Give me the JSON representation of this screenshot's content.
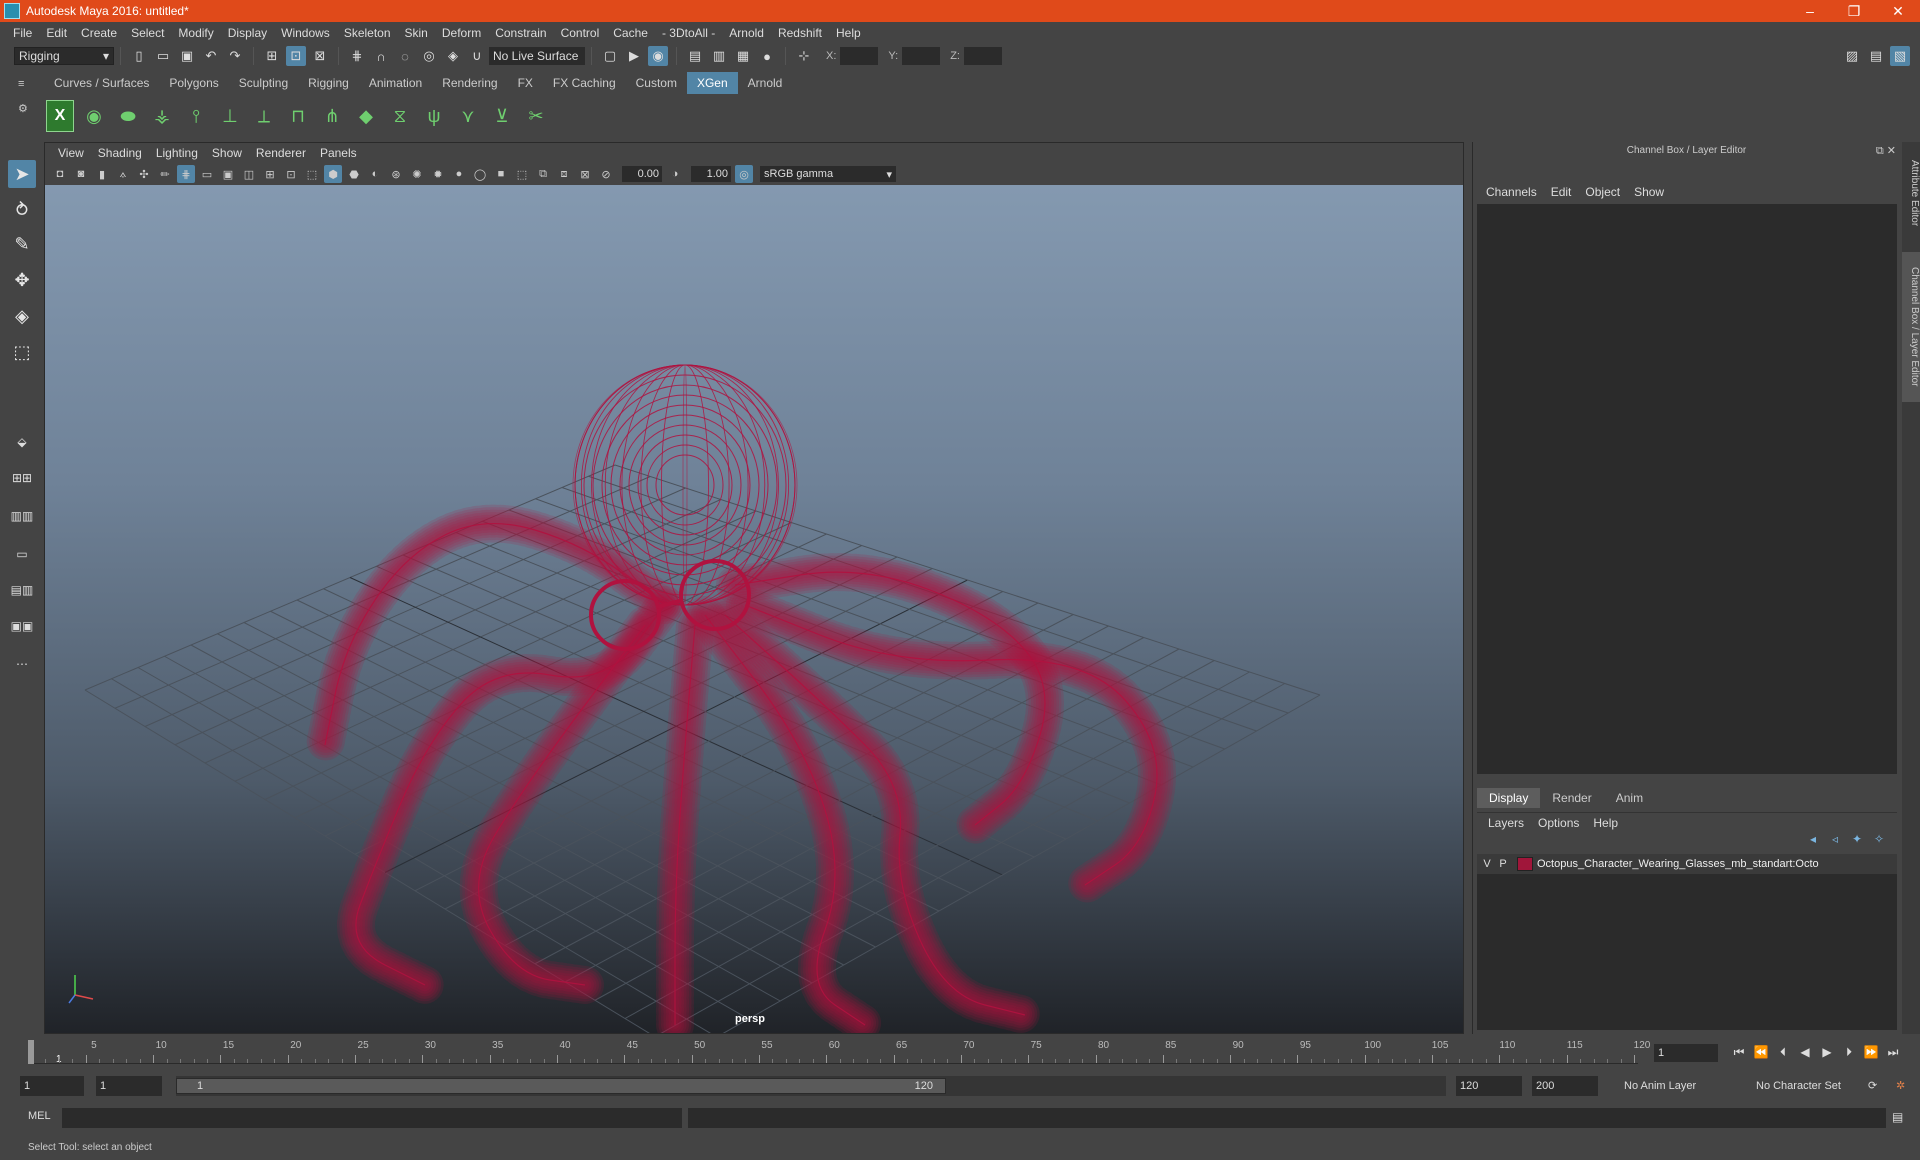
{
  "window": {
    "title": "Autodesk Maya 2016: untitled*",
    "minimize": "–",
    "restore": "❐",
    "close": "✕"
  },
  "menubar": [
    "File",
    "Edit",
    "Create",
    "Select",
    "Modify",
    "Display",
    "Windows",
    "Skeleton",
    "Skin",
    "Deform",
    "Constrain",
    "Control",
    "Cache",
    "- 3DtoAll -",
    "Arnold",
    "Redshift",
    "Help"
  ],
  "statusline": {
    "mode": "Rigging",
    "live_surface": "No Live Surface",
    "x_label": "X:",
    "y_label": "Y:",
    "z_label": "Z:"
  },
  "shelf": {
    "tabs": [
      "Curves / Surfaces",
      "Polygons",
      "Sculpting",
      "Rigging",
      "Animation",
      "Rendering",
      "FX",
      "FX Caching",
      "Custom",
      "XGen",
      "Arnold"
    ],
    "active_tab": "XGen",
    "xgen_label": "X"
  },
  "viewport": {
    "menu": [
      "View",
      "Shading",
      "Lighting",
      "Show",
      "Renderer",
      "Panels"
    ],
    "exposure": "0.00",
    "gamma": "1.00",
    "color_space": "sRGB gamma",
    "camera": "persp",
    "wire_color": "#b0123f"
  },
  "channel_box": {
    "title": "Channel Box / Layer Editor",
    "menu": [
      "Channels",
      "Edit",
      "Object",
      "Show"
    ]
  },
  "layer_editor": {
    "tabs": [
      "Display",
      "Render",
      "Anim"
    ],
    "active_tab": "Display",
    "menu": [
      "Layers",
      "Options",
      "Help"
    ],
    "layers": [
      {
        "v": "V",
        "p": "P",
        "color": "#a0163a",
        "name": "Octopus_Character_Wearing_Glasses_mb_standart:Octo"
      }
    ]
  },
  "side_tabs": [
    "Attribute Editor",
    "Channel Box / Layer Editor"
  ],
  "timeslider": {
    "ticks": [
      1,
      5,
      10,
      15,
      20,
      25,
      30,
      35,
      40,
      45,
      50,
      55,
      60,
      65,
      70,
      75,
      80,
      85,
      90,
      95,
      100,
      105,
      110,
      115,
      120
    ],
    "current_frame": "1",
    "current_frame_field": "1"
  },
  "range": {
    "start": "1",
    "playback_start": "1",
    "range_start": "1",
    "range_end": "120",
    "playback_end": "120",
    "end": "200",
    "anim_layer": "No Anim Layer",
    "character_set": "No Character Set"
  },
  "command_line": {
    "label": "MEL"
  },
  "help_line": {
    "text": "Select Tool: select an object"
  }
}
